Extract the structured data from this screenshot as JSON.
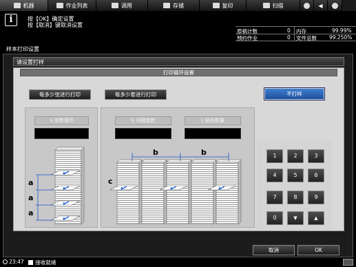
{
  "tabs": [
    {
      "label": "机器",
      "icon": "machine-icon"
    },
    {
      "label": "作业列表",
      "icon": "job-list-icon"
    },
    {
      "label": "调用",
      "icon": "recall-icon"
    },
    {
      "label": "存储",
      "icon": "store-icon"
    },
    {
      "label": "复印",
      "icon": "copy-icon"
    },
    {
      "label": "扫描",
      "icon": "scan-icon"
    }
  ],
  "message": {
    "line1": "按【OK】确定设置",
    "line2": "按【取消】键取消设置"
  },
  "status": {
    "copies_label": "原稿计数",
    "copies_value": "0",
    "memory_label": "内存",
    "memory_value": "99.99%",
    "reserved_label": "预约作业",
    "reserved_value": "0",
    "files_label": "文件总数",
    "files_value": "99.250%"
  },
  "screen_title": "样本打印设置",
  "subtitle": "请设置打样",
  "panel_title": "打印循环设置",
  "buttons": {
    "per_sheets": "每多少张进行打印",
    "per_sets": "每多少套进行打印",
    "no_sample": "不打样"
  },
  "fields": {
    "a_label": "a 张数循环",
    "b_label": "b 间隔套数",
    "c_label": "c 抽张数量"
  },
  "diagram": {
    "a": "a",
    "b": "b",
    "c": "c"
  },
  "keypad": [
    "1",
    "2",
    "3",
    "4",
    "5",
    "6",
    "7",
    "8",
    "9",
    "0",
    "▼",
    "▲"
  ],
  "footer": {
    "cancel": "取消",
    "ok": "OK"
  },
  "bottom": {
    "time": "23:47",
    "job_status": "接收就绪"
  }
}
